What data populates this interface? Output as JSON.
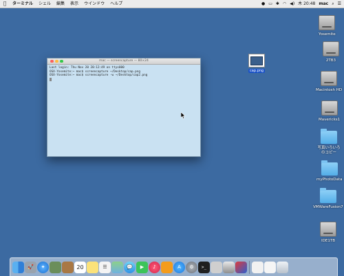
{
  "menubar": {
    "app_name": "ターミナル",
    "items": [
      "シェル",
      "編集",
      "表示",
      "ウインドウ",
      "ヘルプ"
    ],
    "clock": "木 20:48",
    "user": "mac"
  },
  "terminal": {
    "title": "mac — screencapture — 80×24",
    "lines": [
      "Last login: Thu Nov 20 20:12:49 on ttys000",
      "OSX-Yosemite:~ mac$ screencapture ~/Desktop/cap.png",
      "OSX-Yosemite:~ mac$ screencapture -w ~/Desktop/cap2.png"
    ]
  },
  "desktop": {
    "file": {
      "label": "cap.png"
    },
    "right_icons": [
      {
        "label": "Yosemite",
        "kind": "drive"
      },
      {
        "label": "2TB3",
        "kind": "drive"
      },
      {
        "label": "Macintosh HD",
        "kind": "drive"
      },
      {
        "label": "Mavericks1",
        "kind": "drive"
      },
      {
        "label": "写真いろいろ のコピー",
        "kind": "folder"
      },
      {
        "label": "myPhotoData",
        "kind": "folder"
      },
      {
        "label": "VMWareFusion7",
        "kind": "folder"
      },
      {
        "label": "IDE1TB",
        "kind": "drive"
      }
    ]
  },
  "dock": {
    "apps": [
      "finder-icon",
      "launchpad-icon",
      "safari-icon",
      "photo-icon",
      "contacts-icon",
      "calendar-icon",
      "notes-icon",
      "reminders-icon",
      "maps-icon",
      "messages-icon",
      "facetime-icon",
      "itunes-icon",
      "ibooks-icon",
      "app-store-icon",
      "system-preferences-icon",
      "terminal-icon",
      "script-icon",
      "disk-utility-icon",
      "vmware-icon"
    ],
    "calendar_day": "20"
  }
}
